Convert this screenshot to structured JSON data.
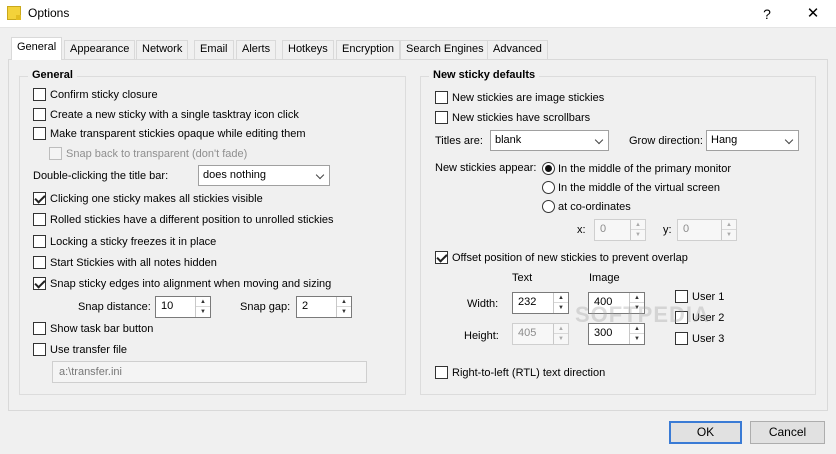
{
  "window": {
    "title": "Options",
    "help_glyph": "?",
    "close_glyph": "✕"
  },
  "tabs": [
    "General",
    "Appearance",
    "Network",
    "Email",
    "Alerts",
    "Hotkeys",
    "Encryption",
    "Search Engines",
    "Advanced"
  ],
  "general": {
    "title": "General",
    "confirm_closure": "Confirm sticky closure",
    "single_click_create": "Create a new sticky with a single tasktray icon click",
    "transparent_opaque": "Make transparent stickies opaque while editing them",
    "snap_back": "Snap back to transparent (don't fade)",
    "dbl_click_label": "Double-clicking the title bar:",
    "dbl_click_value": "does nothing",
    "click_one_visible": "Clicking one sticky makes all stickies visible",
    "rolled_position": "Rolled stickies have a different position to unrolled stickies",
    "locking_freezes": "Locking a sticky freezes it in place",
    "start_hidden": "Start Stickies with all notes hidden",
    "snap_edges": "Snap sticky edges into alignment when moving and sizing",
    "snap_distance_label": "Snap distance:",
    "snap_distance": "10",
    "snap_gap_label": "Snap gap:",
    "snap_gap": "2",
    "taskbar_button": "Show task bar button",
    "use_transfer": "Use transfer file",
    "transfer_path": "a:\\transfer.ini"
  },
  "defaults": {
    "title": "New sticky defaults",
    "image_stickies": "New stickies are image stickies",
    "scrollbars": "New stickies have scrollbars",
    "titles_label": "Titles are:",
    "titles_value": "blank",
    "grow_label": "Grow direction:",
    "grow_value": "Hang",
    "appear_label": "New stickies appear:",
    "appear_primary": "In the middle of the primary monitor",
    "appear_virtual": "In the middle of the virtual screen",
    "appear_coords": "at co-ordinates",
    "x_label": "x:",
    "x_value": "0",
    "y_label": "y:",
    "y_value": "0",
    "offset_overlap": "Offset position of new stickies to prevent overlap",
    "text_col": "Text",
    "image_col": "Image",
    "width_label": "Width:",
    "height_label": "Height:",
    "text_width": "232",
    "text_height": "405",
    "image_width": "400",
    "image_height": "300",
    "user1": "User 1",
    "user2": "User 2",
    "user3": "User 3",
    "rtl": "Right-to-left (RTL) text direction"
  },
  "buttons": {
    "ok": "OK",
    "cancel": "Cancel"
  },
  "watermark": "SOFTPEDIA"
}
